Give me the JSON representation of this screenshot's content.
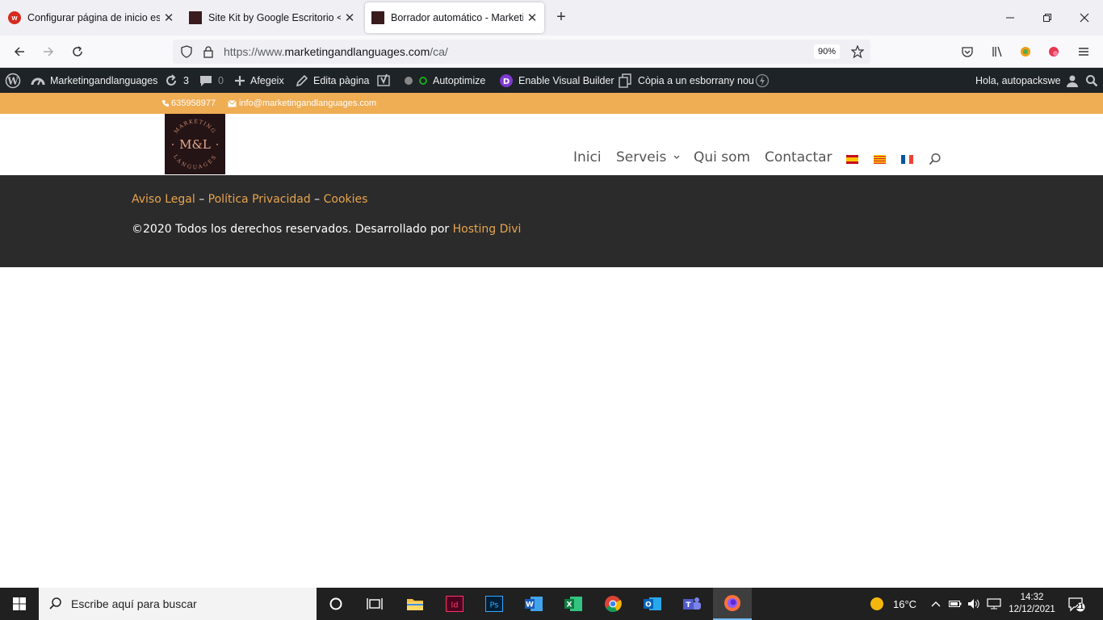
{
  "browser": {
    "tabs": [
      {
        "title": "Configurar página de inicio está",
        "active": false
      },
      {
        "title": "Site Kit by Google Escritorio < M",
        "active": false
      },
      {
        "title": "Borrador automático - Marketin",
        "active": true
      }
    ],
    "new_tab_label": "+",
    "url_prefix": "https://www.",
    "url_domain": "marketingandlanguages.com",
    "url_path": "/ca/",
    "zoom": "90%"
  },
  "admin_bar": {
    "site_name": "Marketingandlanguages",
    "updates_count": "3",
    "comments_count": "0",
    "new_label": "Afegeix",
    "edit_label": "Edita pàgina",
    "autoptimize_label": "Autoptimize",
    "visual_builder_label": "Enable Visual Builder",
    "copy_label": "Còpia a un esborrany nou",
    "greeting": "Hola, autopackswe"
  },
  "topbar": {
    "phone": "635958977",
    "email": "info@marketingandlanguages.com"
  },
  "header": {
    "logo_text_top": "MARKETING",
    "logo_text_mid": "M&L",
    "logo_text_bottom": "LANGUAGES",
    "menu": {
      "home": "Inici",
      "services": "Serveis",
      "about": "Qui som",
      "contact": "Contactar"
    }
  },
  "footer": {
    "legal": "Aviso Legal",
    "sep1": " – ",
    "privacy": "Política Privacidad",
    "sep2": " – ",
    "cookies": "Cookies",
    "copyright": "©2020 Todos los derechos reservados. Desarrollado por ",
    "credit_link": "Hosting Divi"
  },
  "taskbar": {
    "search_placeholder": "Escribe aquí para buscar",
    "weather": "16°C",
    "time": "14:32",
    "date": "12/12/2021",
    "notifications": "21"
  },
  "colors": {
    "accent_orange": "#efad54",
    "footer_link": "#e8a44e",
    "admin_bar": "#1d2327",
    "footer_bg": "#2b2b2b"
  }
}
